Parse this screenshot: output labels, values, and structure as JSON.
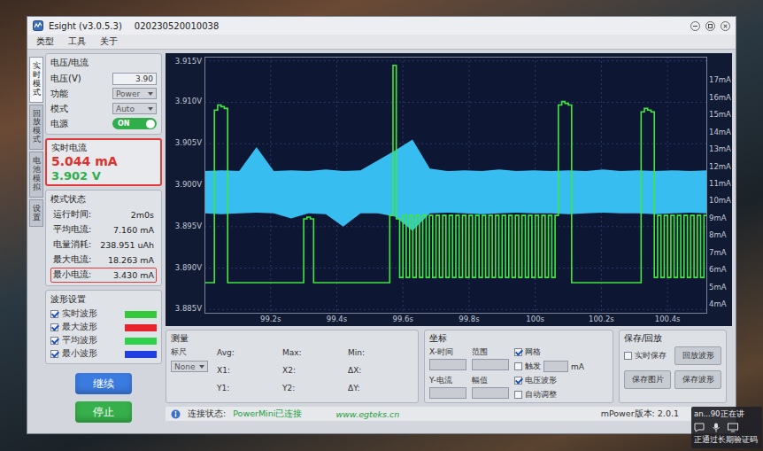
{
  "window": {
    "title": "Esight (v3.0.5.3)",
    "serial": "020230520010038"
  },
  "menu": [
    {
      "label": "类型"
    },
    {
      "label": "工具"
    },
    {
      "label": "关于"
    }
  ],
  "side_tabs": [
    {
      "label": "实时模式",
      "selected": true
    },
    {
      "label": "回放模式",
      "selected": false
    },
    {
      "label": "电池模拟",
      "selected": false
    },
    {
      "label": "设置",
      "selected": false
    }
  ],
  "settings": {
    "title": "电压/电流",
    "fields": [
      {
        "label": "电压(V)",
        "value": "3.90",
        "kind": "input"
      },
      {
        "label": "功能",
        "value": "Power",
        "kind": "select"
      },
      {
        "label": "模式",
        "value": "Auto",
        "kind": "select"
      },
      {
        "label": "电源",
        "value": "ON",
        "kind": "toggle",
        "on": true
      }
    ]
  },
  "realtime": {
    "title": "实时电流",
    "current": "5.044 mA",
    "voltage": "3.902 V",
    "highlighted": true
  },
  "stats": {
    "title": "模式状态",
    "rows": [
      {
        "label": "运行时间:",
        "value": "2m0s",
        "highlighted": false
      },
      {
        "label": "平均电流:",
        "value": "7.160 mA",
        "highlighted": false
      },
      {
        "label": "电量消耗:",
        "value": "238.951 uAh",
        "highlighted": false
      },
      {
        "label": "最大电流:",
        "value": "18.263 mA",
        "highlighted": false
      },
      {
        "label": "最小电流:",
        "value": "3.430 mA",
        "highlighted": true
      }
    ]
  },
  "waveform_settings": {
    "title": "波形设置",
    "items": [
      {
        "label": "实时波形",
        "checked": true,
        "color": "#34c93a"
      },
      {
        "label": "最大波形",
        "checked": true,
        "color": "#e8232b"
      },
      {
        "label": "平均波形",
        "checked": true,
        "color": "#2fd04a"
      },
      {
        "label": "最小波形",
        "checked": true,
        "color": "#1f3fe0"
      }
    ]
  },
  "buttons": [
    {
      "label": "继续",
      "color": "#3a7be0"
    },
    {
      "label": "停止",
      "color": "#36b04a"
    }
  ],
  "chart": {
    "y_left_ticks": [
      "3.915V",
      "3.910V",
      "3.905V",
      "3.900V",
      "3.895V",
      "3.890V",
      "3.885V"
    ],
    "y_right_ticks": [
      "17mA",
      "16mA",
      "15mA",
      "14mA",
      "13mA",
      "12mA",
      "11mA",
      "10mA",
      "9mA",
      "8mA",
      "7mA",
      "6mA",
      "5mA",
      "4mA"
    ],
    "x_ticks": [
      "99.2s",
      "99.4s",
      "99.6s",
      "99.8s",
      "100s",
      "100.2s",
      "100.4s"
    ],
    "t_start": 99.0,
    "t_end": 100.52,
    "current": {
      "unit": "mA",
      "dt": 0.01,
      "color": "#3ee83e",
      "values": [
        5.3,
        5.3,
        5.3,
        15.3,
        15.6,
        15.5,
        15.4,
        5.3,
        5.3,
        5.3,
        5.3,
        5.3,
        5.3,
        5.3,
        5.3,
        5.3,
        5.3,
        5.3,
        5.3,
        5.3,
        5.3,
        5.3,
        5.3,
        5.3,
        5.3,
        5.3,
        5.3,
        5.3,
        5.3,
        5.3,
        9.0,
        9.1,
        9.0,
        5.3,
        5.3,
        5.3,
        5.3,
        5.3,
        5.3,
        5.3,
        5.3,
        5.3,
        5.3,
        5.3,
        5.3,
        5.3,
        5.3,
        5.3,
        5.3,
        5.3,
        5.3,
        5.3,
        5.3,
        5.3,
        5.3,
        5.3,
        9.2,
        17.9,
        9.0,
        5.6,
        9.2,
        5.6,
        9.2,
        5.6,
        9.2,
        5.6,
        9.2,
        5.6,
        9.2,
        5.6,
        9.2,
        5.6,
        9.2,
        5.6,
        9.2,
        5.6,
        9.2,
        5.6,
        9.2,
        5.6,
        9.2,
        5.6,
        9.2,
        5.6,
        9.2,
        5.6,
        9.2,
        5.6,
        9.2,
        5.6,
        9.2,
        5.6,
        9.2,
        5.6,
        9.2,
        5.6,
        9.2,
        5.6,
        9.2,
        5.6,
        9.2,
        5.6,
        9.2,
        5.6,
        9.2,
        5.6,
        9.2,
        15.6,
        15.8,
        15.7,
        15.6,
        5.3,
        5.3,
        5.3,
        5.3,
        5.3,
        5.3,
        5.3,
        5.3,
        5.3,
        5.3,
        5.3,
        5.3,
        5.3,
        5.3,
        5.3,
        5.3,
        5.3,
        5.3,
        5.3,
        5.3,
        5.3,
        15.2,
        15.4,
        15.3,
        15.2,
        5.6,
        9.2,
        5.6,
        9.2,
        5.6,
        9.2,
        5.6,
        9.2,
        5.6,
        9.2,
        5.6,
        9.2,
        5.6,
        9.2,
        5.6,
        9.2
      ]
    },
    "voltage_band": {
      "unit": "V",
      "color": "#38bdf0",
      "max": [
        3.9017,
        3.9018,
        3.9017,
        3.9046,
        3.9017,
        3.9018,
        3.9017,
        3.9019,
        3.9017,
        3.9018,
        3.903,
        3.9042,
        3.9055,
        3.902,
        3.9017,
        3.9018,
        3.9017,
        3.9019,
        3.9017,
        3.9018,
        3.9017,
        3.9018,
        3.9017,
        3.9019,
        3.9017,
        3.9018,
        3.9017,
        3.9018,
        3.9017,
        3.9018
      ],
      "min": [
        3.8966,
        3.8965,
        3.8966,
        3.8967,
        3.8966,
        3.896,
        3.8966,
        3.8965,
        3.895,
        3.8966,
        3.8966,
        3.8962,
        3.8945,
        3.8966,
        3.8967,
        3.8966,
        3.8965,
        3.8966,
        3.8967,
        3.8966,
        3.8966,
        3.8965,
        3.8966,
        3.8967,
        3.8966,
        3.8966,
        3.8965,
        3.8966,
        3.8967,
        3.8966
      ]
    }
  },
  "measure": {
    "title": "测量",
    "ruler_label": "标尺",
    "ruler_value": "None",
    "readouts": [
      "Avg:",
      "Max:",
      "Min:",
      "X1:",
      "X2:",
      "ΔX:",
      "Y1:",
      "Y2:",
      "ΔY:"
    ]
  },
  "axes": {
    "title": "坐标",
    "fields": [
      {
        "label": "X-时间",
        "value": ""
      },
      {
        "label": "范围",
        "value": ""
      },
      {
        "label": "Y-电流",
        "value": ""
      },
      {
        "label": "幅值",
        "value": ""
      }
    ],
    "options": [
      {
        "label": "网格",
        "checked": true,
        "kind": "check"
      },
      {
        "label": "触发",
        "checked": false,
        "kind": "check-input",
        "value": "",
        "unit": "mA"
      },
      {
        "label": "电压波形",
        "checked": true,
        "kind": "check"
      },
      {
        "label": "自动调整",
        "checked": false,
        "kind": "check"
      }
    ]
  },
  "save": {
    "title": "保存/回放",
    "realtime_save": {
      "label": "实时保存",
      "checked": false
    },
    "buttons": [
      "回放波形",
      "保存图片",
      "保存波形"
    ]
  },
  "status_bar": {
    "connection_label": "连接状态:",
    "connection_value": "PowerMini已连接",
    "website": "www.egteks.cn",
    "version": "mPower版本: 2.0.1"
  },
  "notification": {
    "title": "an...90正在讲",
    "subtitle": "正通过长期验证码"
  }
}
